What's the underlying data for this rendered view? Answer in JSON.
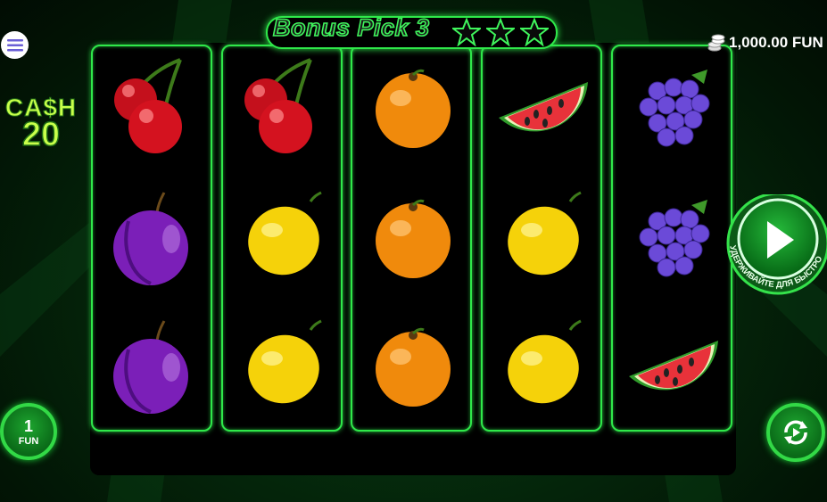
{
  "game": {
    "title": "Bonus Pick 3",
    "stars_count": 3
  },
  "cash": {
    "label": "CA$H",
    "value": "20"
  },
  "balance": {
    "amount": "1,000.00 FUN"
  },
  "bet": {
    "value": "1",
    "unit": "FUN"
  },
  "spin": {
    "hold_hint": "УДЕРЖИВАЙТЕ ДЛЯ БЫСТРОЙ ИГРЫ"
  },
  "reels": [
    [
      "cherry",
      "plum",
      "plum"
    ],
    [
      "cherry",
      "lemon",
      "lemon"
    ],
    [
      "orange",
      "orange",
      "orange"
    ],
    [
      "watermelon",
      "lemon",
      "lemon"
    ],
    [
      "grapes",
      "grapes",
      "watermelon"
    ]
  ],
  "colors": {
    "accent": "#2fe84a",
    "cash_text": "#c8ff4a",
    "background": "#021a08"
  }
}
